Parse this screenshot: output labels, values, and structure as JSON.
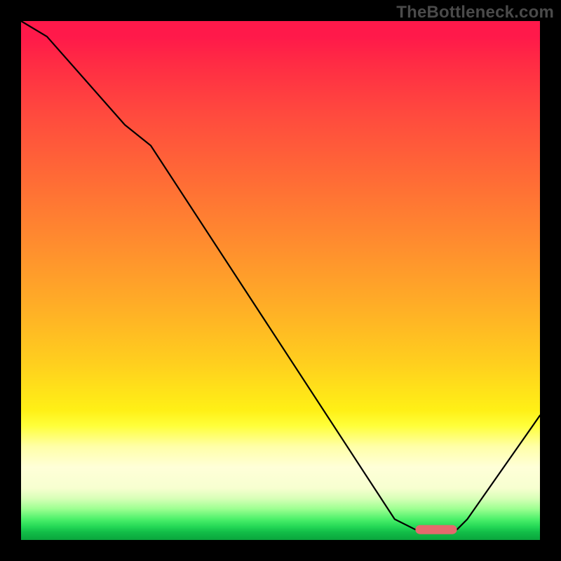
{
  "watermark": "TheBottleneck.com",
  "chart_data": {
    "type": "line",
    "title": "",
    "xlabel": "",
    "ylabel": "",
    "xlim": [
      0,
      100
    ],
    "ylim": [
      0,
      100
    ],
    "grid": false,
    "legend": false,
    "series": [
      {
        "name": "bottleneck-curve",
        "x": [
          0,
          5,
          20,
          25,
          72,
          76,
          84,
          86,
          100
        ],
        "values": [
          100,
          97,
          80,
          76,
          4,
          2,
          2,
          4,
          24
        ]
      }
    ],
    "marker": {
      "name": "optimal-range",
      "x_start": 76,
      "x_end": 84,
      "y": 2,
      "color": "#e46a6d"
    },
    "background_gradient": {
      "top": "#ff194a",
      "mid": "#fff016",
      "pale": "#ffffd8",
      "green": "#0aa53d"
    }
  }
}
